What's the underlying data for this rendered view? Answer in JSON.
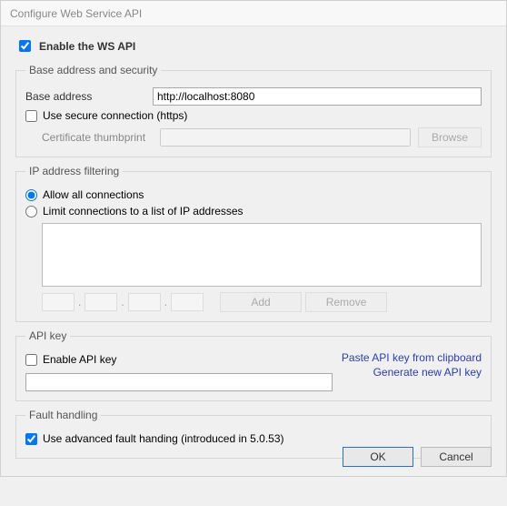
{
  "title": "Configure Web Service API",
  "enable_api": {
    "label": "Enable the WS API",
    "checked": true
  },
  "base_security": {
    "legend": "Base address and security",
    "base_address_label": "Base address",
    "base_address_value": "http://localhost:8080",
    "use_secure": {
      "label": "Use secure connection (https)",
      "checked": false
    },
    "cert_label": "Certificate thumbprint",
    "cert_value": "",
    "browse_label": "Browse"
  },
  "ip_filter": {
    "legend": "IP address filtering",
    "allow_all": {
      "label": "Allow all connections",
      "checked": true
    },
    "limit_list": {
      "label": "Limit connections to a list of IP addresses",
      "checked": false
    },
    "add_label": "Add",
    "remove_label": "Remove"
  },
  "api_key": {
    "legend": "API key",
    "enable": {
      "label": "Enable API key",
      "checked": false
    },
    "value": "",
    "paste_link": "Paste API key from clipboard",
    "generate_link": "Generate new API key"
  },
  "fault": {
    "legend": "Fault handling",
    "advanced": {
      "label": "Use advanced fault handing (introduced in 5.0.53)",
      "checked": true
    }
  },
  "footer": {
    "ok": "OK",
    "cancel": "Cancel"
  }
}
